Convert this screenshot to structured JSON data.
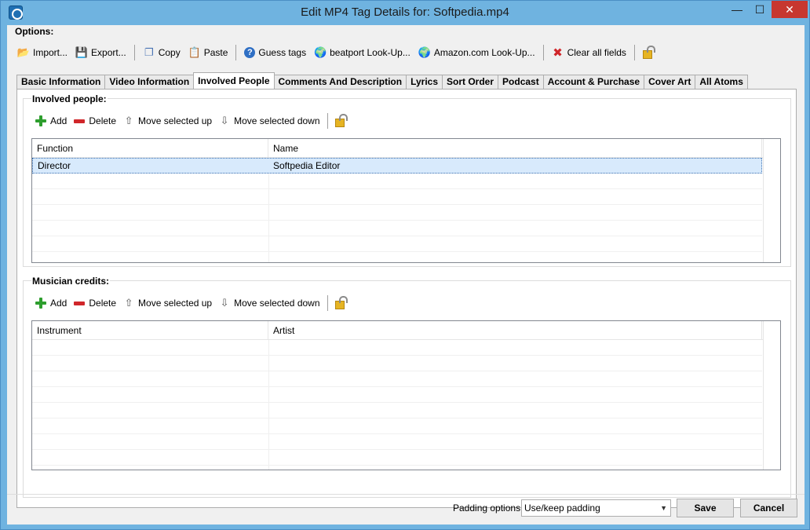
{
  "window": {
    "title": "Edit MP4 Tag Details for: Softpedia.mp4",
    "minimize": "—",
    "maximize": "☐",
    "close": "✕"
  },
  "options_label": "Options:",
  "toolbar": {
    "import": "Import...",
    "export": "Export...",
    "copy": "Copy",
    "paste": "Paste",
    "guess_tags": "Guess tags",
    "beatport": "beatport Look-Up...",
    "amazon": "Amazon.com Look-Up...",
    "clear_all": "Clear all fields"
  },
  "tabs": [
    "Basic Information",
    "Video Information",
    "Involved People",
    "Comments And Description",
    "Lyrics",
    "Sort Order",
    "Podcast",
    "Account & Purchase",
    "Cover Art",
    "All Atoms"
  ],
  "active_tab": "Involved People",
  "involved_people": {
    "title": "Involved people:",
    "toolbar": {
      "add": "Add",
      "delete": "Delete",
      "move_up": "Move selected up",
      "move_down": "Move selected down"
    },
    "columns": [
      "Function",
      "Name"
    ],
    "rows": [
      {
        "function": "Director",
        "name": "Softpedia Editor"
      }
    ]
  },
  "musician_credits": {
    "title": "Musician credits:",
    "toolbar": {
      "add": "Add",
      "delete": "Delete",
      "move_up": "Move selected up",
      "move_down": "Move selected down"
    },
    "columns": [
      "Instrument",
      "Artist"
    ],
    "rows": []
  },
  "footer": {
    "padding_label": "Padding options:",
    "padding_value": "Use/keep padding",
    "save": "Save",
    "cancel": "Cancel"
  },
  "colors": {
    "titlebar": "#6fb3e0",
    "close_button": "#c7372f",
    "selection": "#d8eafc"
  }
}
